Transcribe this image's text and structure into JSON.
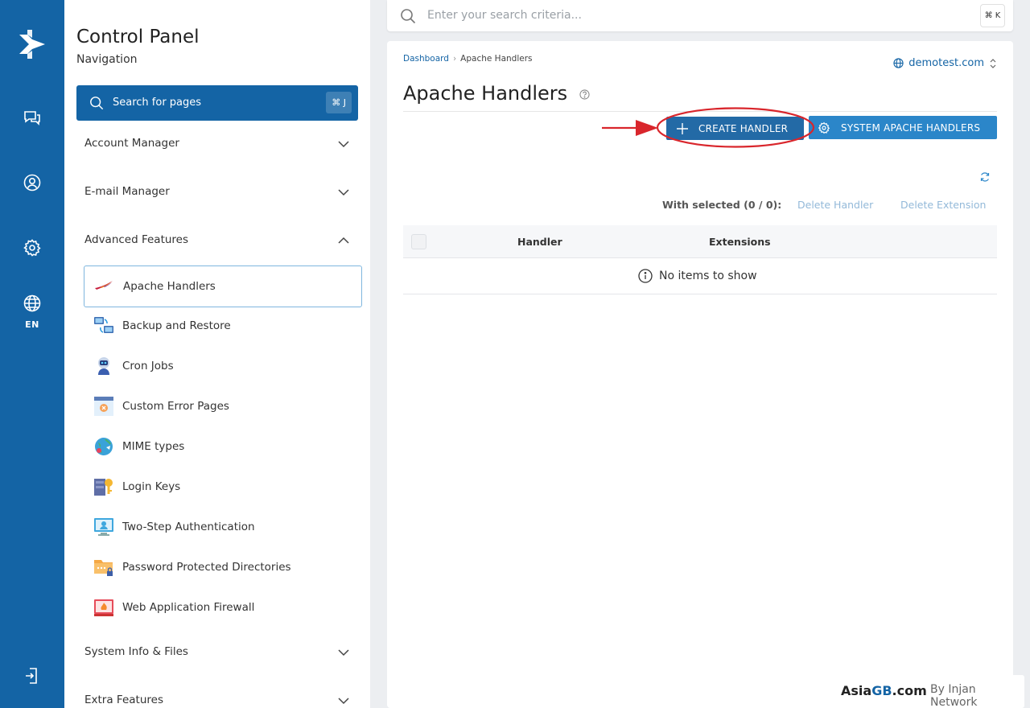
{
  "rail": {
    "lang": "EN"
  },
  "nav": {
    "title": "Control Panel",
    "subtitle": "Navigation",
    "search_label": "Search for pages",
    "search_shortcut": "⌘ J",
    "sections": [
      {
        "label": "Account Manager",
        "expanded": false
      },
      {
        "label": "E-mail Manager",
        "expanded": false
      },
      {
        "label": "Advanced Features",
        "expanded": true
      },
      {
        "label": "System Info & Files",
        "expanded": false
      },
      {
        "label": "Extra Features",
        "expanded": false
      }
    ],
    "items": [
      {
        "label": "Apache Handlers",
        "icon": "apache-feather-icon",
        "active": true
      },
      {
        "label": "Backup and Restore",
        "icon": "backup-computers-icon"
      },
      {
        "label": "Cron Jobs",
        "icon": "robot-icon"
      },
      {
        "label": "Custom Error Pages",
        "icon": "error-page-icon"
      },
      {
        "label": "MIME types",
        "icon": "globe-arrows-icon"
      },
      {
        "label": "Login Keys",
        "icon": "key-server-icon"
      },
      {
        "label": "Two-Step Authentication",
        "icon": "two-step-monitor-icon"
      },
      {
        "label": "Password Protected Directories",
        "icon": "locked-folder-icon"
      },
      {
        "label": "Web Application Firewall",
        "icon": "firewall-icon"
      }
    ]
  },
  "topbar": {
    "search_placeholder": "Enter your search criteria...",
    "shortcut": "⌘ K"
  },
  "page": {
    "breadcrumb": [
      "Dashboard",
      "Apache Handlers"
    ],
    "domain": "demotest.com",
    "title": "Apache Handlers",
    "create_button": "CREATE HANDLER",
    "system_button": "SYSTEM APACHE HANDLERS",
    "with_selected": "With selected (0 / 0):",
    "actions": [
      "Delete Handler",
      "Delete Extension"
    ],
    "columns": [
      "Handler",
      "Extensions"
    ],
    "empty_message": "No items to show"
  },
  "colors": {
    "brand": "#1464a5",
    "button_primary": "#236aa6",
    "button_secondary": "#2b86c9",
    "annotation": "#d9262c"
  },
  "watermark": {
    "brand_prefix": "Asia",
    "brand_gb": "GB",
    "brand_suffix": ".com",
    "by": "By Injan Network"
  }
}
